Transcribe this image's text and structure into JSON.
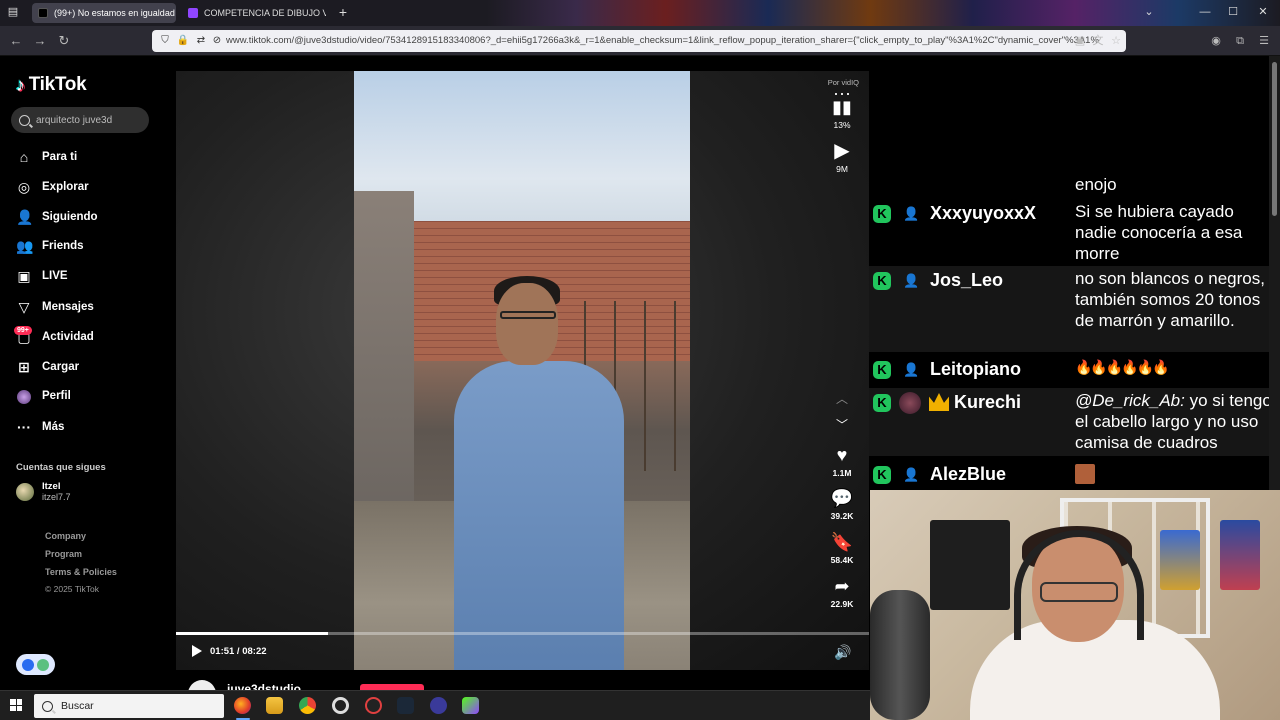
{
  "browser": {
    "tabs": [
      {
        "title": "(99+) No estamos en igualdad d",
        "active": true
      },
      {
        "title": "COMPETENCIA DE DIBUJO VS N",
        "active": false
      }
    ],
    "url": "www.tiktok.com/@juve3dstudio/video/7534128915183340806?_d=ehii5g17266a3k&_r=1&enable_checksum=1&link_reflow_popup_iteration_sharer={\"click_empty_to_play\"%3A1%2C\"dynamic_cover\"%3A1%"
  },
  "tiktok": {
    "logo": "TikTok",
    "search_value": "arquitecto juve3d",
    "nav": [
      {
        "label": "Para ti",
        "icon": "home-icon"
      },
      {
        "label": "Explorar",
        "icon": "compass-icon"
      },
      {
        "label": "Siguiendo",
        "icon": "user-follow-icon"
      },
      {
        "label": "Friends",
        "icon": "friends-icon"
      },
      {
        "label": "LIVE",
        "icon": "live-icon"
      },
      {
        "label": "Mensajes",
        "icon": "inbox-icon"
      },
      {
        "label": "Actividad",
        "icon": "activity-icon"
      },
      {
        "label": "Cargar",
        "icon": "upload-icon"
      },
      {
        "label": "Perfil",
        "icon": "profile-icon"
      },
      {
        "label": "Más",
        "icon": "more-icon"
      }
    ],
    "activity_badge": "99+",
    "following_heading": "Cuentas que sigues",
    "following": [
      {
        "name": "Itzel",
        "username": "itzel7.7"
      }
    ],
    "footer": [
      "Company",
      "Program",
      "Terms & Policies",
      "© 2025 TikTok"
    ]
  },
  "video": {
    "vidiq_label": "Por vidIQ",
    "stat_percent": "13%",
    "views": "9M",
    "likes": "1.1M",
    "comments": "39.2K",
    "saves": "58.4K",
    "shares": "22.9K",
    "time": "01:51 / 08:22",
    "progress_fraction": 0.22,
    "author": "juve3dstudio"
  },
  "chat": {
    "messages": [
      {
        "user": "",
        "text": "enojo"
      },
      {
        "user": "XxxyuyoxxX",
        "text": "Si se hubiera cayado nadie conocería a esa morre"
      },
      {
        "user": "Jos_Leo",
        "text": "no son blancos o negros, también somos 20 tonos de marrón y amarillo."
      },
      {
        "user": "Leitopiano",
        "text": "🔥🔥🔥🔥🔥🔥"
      },
      {
        "user": "Kurechi",
        "text": "@De_rick_Ab: yo si tengo el cabello largo y no uso camisa de cuadros"
      },
      {
        "user": "AlezBlue",
        "text": ""
      }
    ],
    "mention": "@De_rick_Ab:",
    "mention_rest": " yo si tengo el cabello largo y no uso camisa de cuadros"
  },
  "taskbar": {
    "search_placeholder": "Buscar"
  },
  "colors": {
    "tiktok_red": "#fe2c55",
    "tiktok_cyan": "#25f4ee",
    "chat_badge_green": "#21c55d"
  }
}
